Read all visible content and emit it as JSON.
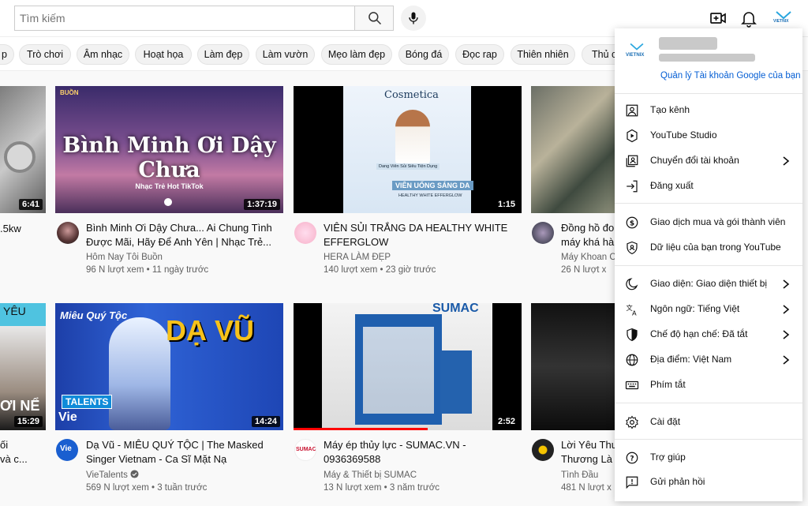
{
  "header": {
    "search_placeholder": "Tìm kiếm",
    "icons": [
      "search-icon",
      "mic-icon",
      "create-video-icon",
      "notifications-icon",
      "account-avatar-icon"
    ],
    "avatar_text": "VIETNIX"
  },
  "chips": [
    "p",
    "Trò chơi",
    "Âm nhạc",
    "Hoạt họa",
    "Làm đẹp",
    "Làm vườn",
    "Mẹo làm đẹp",
    "Bóng đá",
    "Đọc rap",
    "Thiên nhiên",
    "Thủ c"
  ],
  "row1": [
    {
      "title": "",
      "title2": "",
      "channel": "",
      "views": "",
      "age": "",
      "duration": "6:41",
      "partial_title": ".5kw"
    },
    {
      "title": "Bình Minh Ơi Dậy Chưa... Ai Chung Tình",
      "title2": "Được Mãi, Hãy Để Anh Yên | Nhạc Trẻ...",
      "channel": "Hôm Nay Tôi Buồn",
      "views": "96 N lượt xem",
      "age": "11 ngày trước",
      "duration": "1:37:19",
      "thumb_text": "Bình Minh Ơi Dậy Chưa",
      "thumb_sub": "Nhạc Trẻ Hot TikTok",
      "thumb_tag": "BUỒN"
    },
    {
      "title": "VIÊN SỦI TRẮNG DA HEALTHY WHITE",
      "title2": "EFFERGLOW",
      "channel": "HERA LÀM ĐẸP",
      "views": "140 lượt xem",
      "age": "23 giờ trước",
      "duration": "1:15",
      "thumb_brand": "Cosmetica",
      "thumb_cap": "Dang Viên Sủi Siêu Tiện Dụng",
      "thumb_bar": "VIÊN UỐNG SÁNG DA",
      "thumb_bar2": "HEALTHY WHITE EFFERGLOW"
    },
    {
      "title": "Đồng hồ đo",
      "title2": "máy khá hà",
      "channel": "Máy Khoan C",
      "views": "26 N lượt x",
      "age": ""
    }
  ],
  "row2": [
    {
      "thumb_top": "YÊU",
      "thumb_mid": "ƠI NỂ",
      "duration": "15:29",
      "title": "ối",
      "title2": "và c..."
    },
    {
      "title": "Dạ Vũ - MIÊU QUÝ TỘC | The Masked",
      "title2": "Singer Vietnam - Ca Sĩ Mặt Nạ",
      "channel": "VieTalents",
      "views": "569 N lượt xem",
      "age": "3 tuần trước",
      "duration": "14:24",
      "thumb_text": "DẠ VŨ",
      "thumb_left": "Miêu Quý Tộc",
      "thumb_badge": "TALENTS",
      "thumb_vie": "Vie"
    },
    {
      "title": "Máy ép thủy lực - SUMAC.VN -",
      "title2": "0936369588",
      "channel": "Máy & Thiết bị SUMAC",
      "views": "13 N lượt xem",
      "age": "3 năm trước",
      "duration": "2:52",
      "thumb_brand": "SUMAC",
      "channel_logo": "SUMAC"
    },
    {
      "title": "Lời Yêu Thư",
      "title2": "Thương Là L",
      "channel": "Tình Đầu",
      "views": "481 N lượt x",
      "age": ""
    }
  ],
  "menu": {
    "logo_text": "VIETNIX",
    "manage_link": "Quản lý Tài khoản Google của bạn",
    "group1": [
      {
        "label": "Tạo kênh",
        "icon": "create-channel-icon",
        "chevron": false
      },
      {
        "label": "YouTube Studio",
        "icon": "youtube-studio-icon",
        "chevron": false
      },
      {
        "label": "Chuyển đổi tài khoản",
        "icon": "switch-account-icon",
        "chevron": true
      },
      {
        "label": "Đăng xuất",
        "icon": "sign-out-icon",
        "chevron": false
      }
    ],
    "group2": [
      {
        "label": "Giao dịch mua và gói thành viên",
        "icon": "purchases-icon",
        "chevron": false
      },
      {
        "label": "Dữ liệu của bạn trong YouTube",
        "icon": "your-data-icon",
        "chevron": false
      }
    ],
    "group3": [
      {
        "label": "Giao diện: Giao diện thiết bị",
        "icon": "appearance-icon",
        "chevron": true
      },
      {
        "label": "Ngôn ngữ: Tiếng Việt",
        "icon": "language-icon",
        "chevron": true
      },
      {
        "label": "Chế độ hạn chế: Đã tắt",
        "icon": "restricted-mode-icon",
        "chevron": true
      },
      {
        "label": "Địa điểm: Việt Nam",
        "icon": "location-icon",
        "chevron": true
      },
      {
        "label": "Phím tắt",
        "icon": "keyboard-icon",
        "chevron": false
      }
    ],
    "group4": [
      {
        "label": "Cài đặt",
        "icon": "settings-icon",
        "chevron": false
      }
    ],
    "group5": [
      {
        "label": "Trợ giúp",
        "icon": "help-icon",
        "chevron": false
      },
      {
        "label": "Gửi phản hồi",
        "icon": "feedback-icon",
        "chevron": false
      }
    ]
  },
  "colors": {
    "link_blue": "#065fd4",
    "chip_bg": "#f2f2f2",
    "menu_bg": "#ffffff"
  }
}
